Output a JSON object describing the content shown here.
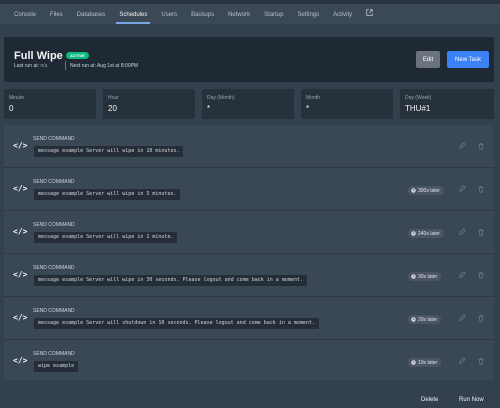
{
  "nav": {
    "items": [
      "Console",
      "Files",
      "Databases",
      "Schedules",
      "Users",
      "Backups",
      "Network",
      "Startup",
      "Settings",
      "Activity"
    ],
    "active": "Schedules"
  },
  "schedule": {
    "name": "Full Wipe",
    "status_badge": "ACTIVE",
    "last_run_label": "Last run at:",
    "last_run_value": "n/a",
    "next_run": "Next run at: Aug 1st at 8:00PM",
    "edit_label": "Edit",
    "new_task_label": "New Task"
  },
  "cron": [
    {
      "label": "Minute",
      "value": "0"
    },
    {
      "label": "Hour",
      "value": "20"
    },
    {
      "label": "Day (Month)",
      "value": "*"
    },
    {
      "label": "Month",
      "value": "*"
    },
    {
      "label": "Day (Week)",
      "value": "THU#1"
    }
  ],
  "tasks": [
    {
      "type": "SEND COMMAND",
      "command": "message example Server will wipe in 10 minutes.",
      "delay": ""
    },
    {
      "type": "SEND COMMAND",
      "command": "message example Server will wipe in 5 minutes.",
      "delay": "300s later"
    },
    {
      "type": "SEND COMMAND",
      "command": "message example Server will wipe in 1 minute.",
      "delay": "240s later"
    },
    {
      "type": "SEND COMMAND",
      "command": "message example Server will wipe in 30 seconds. Please logout and come back in a moment.",
      "delay": "30s later"
    },
    {
      "type": "SEND COMMAND",
      "command": "message example Server will shutdown in 10 seconds. Please logout and come back in a moment.",
      "delay": "20s later"
    },
    {
      "type": "SEND COMMAND",
      "command": "wipe example",
      "delay": "10s later"
    }
  ],
  "footer": {
    "delete_label": "Delete",
    "run_now_label": "Run Now"
  },
  "colors": {
    "accent": "#3b82f6",
    "active_badge": "#10b981",
    "background": "#33404d"
  }
}
